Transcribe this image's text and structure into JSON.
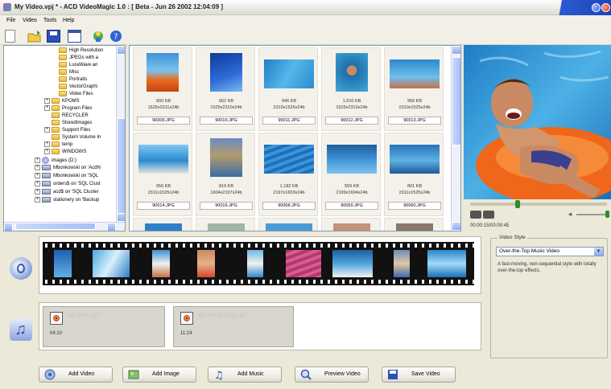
{
  "window": {
    "title": "My Video.vpj * - ACD VideoMagic 1.0 : [ Beta - Jun 26 2002 12:04:09 ]"
  },
  "menu": [
    "File",
    "Video",
    "Tools",
    "Help"
  ],
  "toolbar_icons": [
    "new-file-icon",
    "open-folder-icon",
    "save-icon",
    "window-icon",
    "acd-globe-icon",
    "help-icon"
  ],
  "folder_tree": [
    {
      "label": "High Resolution",
      "type": "folder"
    },
    {
      "label": "JPEGs with a",
      "type": "folder"
    },
    {
      "label": "LuraWave an",
      "type": "folder"
    },
    {
      "label": "Misc",
      "type": "folder"
    },
    {
      "label": "Portraits",
      "type": "folder"
    },
    {
      "label": "VectorGraphi",
      "type": "folder"
    },
    {
      "label": "Video Files",
      "type": "folder"
    },
    {
      "label": "KPOMS",
      "type": "folder"
    },
    {
      "label": "Program Files",
      "type": "folder"
    },
    {
      "label": "RECYCLER",
      "type": "folder"
    },
    {
      "label": "StoredImages",
      "type": "folder"
    },
    {
      "label": "Support Files",
      "type": "folder"
    },
    {
      "label": "System Volume In",
      "type": "folder"
    },
    {
      "label": "temp",
      "type": "folder"
    },
    {
      "label": "WINDOWS",
      "type": "folder"
    },
    {
      "label": "images (D:)",
      "type": "drive"
    },
    {
      "label": "Mbonkowski on 'AcdN",
      "type": "net"
    },
    {
      "label": "Mbonkowski on 'SQL",
      "type": "net"
    },
    {
      "label": "orders$ on 'SQL Clust",
      "type": "net"
    },
    {
      "label": "acd$ on 'SQL Cluster",
      "type": "net"
    },
    {
      "label": "stationery on 'Backup",
      "type": "net"
    }
  ],
  "thumbnails": [
    {
      "size": "900 KB",
      "dims": "1525x2311x24b",
      "name": "90009.JPG"
    },
    {
      "size": "662 KB",
      "dims": "1525x2310x24b",
      "name": "90010.JPG"
    },
    {
      "size": "946 KB",
      "dims": "2310x1525x24b",
      "name": "90011.JPG"
    },
    {
      "size": "1,010 KB",
      "dims": "1525x2310x24b",
      "name": "90012.JPG"
    },
    {
      "size": "950 KB",
      "dims": "2310x1525x24b",
      "name": "90013.JPG"
    },
    {
      "size": "956 KB",
      "dims": "2311x1525x24b",
      "name": "90014.JPG"
    },
    {
      "size": "819 KB",
      "dims": "1604x2197x24b",
      "name": "90016.JPG"
    },
    {
      "size": "1,182 KB",
      "dims": "2197x1603x24b",
      "name": "90058.JPG"
    },
    {
      "size": "559 KB",
      "dims": "2199x1604x24b",
      "name": "90059.JPG"
    },
    {
      "size": "801 KB",
      "dims": "2311x1525x24b",
      "name": "90060.JPG"
    }
  ],
  "preview": {
    "timecode": "00:00:15/00:00:45",
    "progress": 0.33
  },
  "audio_clips": [
    {
      "name": "The Band.mp3",
      "duration": "04:10"
    },
    {
      "name": "My Favorite Song.mp3",
      "duration": "11:24"
    }
  ],
  "video_style": {
    "legend": "Video Style",
    "selected": "Over-the-Top Music Video",
    "description": "A fast-moving, non-sequential style with totally over-the-top effects."
  },
  "buttons": {
    "add_video": "Add Video",
    "add_image": "Add Image",
    "add_music": "Add Music",
    "preview_video": "Preview Video",
    "save_video": "Save Video"
  }
}
